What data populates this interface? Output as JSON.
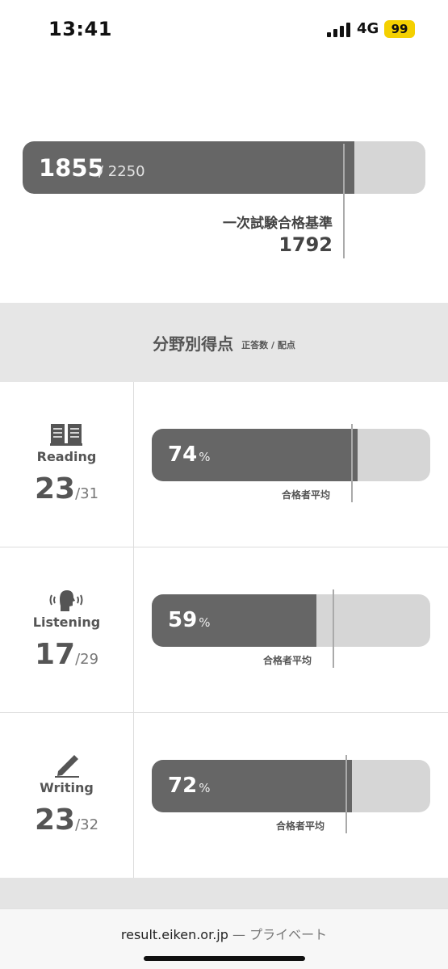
{
  "status": {
    "time": "13:41",
    "network": "4G",
    "battery": "99"
  },
  "total": {
    "score": "1855",
    "max": "/ 2250",
    "fill_ratio": 0.8244,
    "pass_label": "一次試験合格基準",
    "pass_value": "1792"
  },
  "section": {
    "title": "分野別得点",
    "subtitle": "正答数 / 配点"
  },
  "skills": [
    {
      "name": "Reading",
      "score": "23",
      "max": "/31",
      "percent": "74",
      "percent_unit": "%",
      "avg_label": "合格者平均",
      "icon": "book-icon",
      "percent_value": 74,
      "avg_value": 71.5
    },
    {
      "name": "Listening",
      "score": "17",
      "max": "/29",
      "percent": "59",
      "percent_unit": "%",
      "avg_label": "合格者平均",
      "icon": "listening-head-icon",
      "percent_value": 59,
      "avg_value": 65
    },
    {
      "name": "Writing",
      "score": "23",
      "max": "/32",
      "percent": "72",
      "percent_unit": "%",
      "avg_label": "合格者平均",
      "icon": "pencil-icon",
      "percent_value": 72,
      "avg_value": 69.5
    }
  ],
  "browser": {
    "url": "result.eiken.or.jp",
    "separator": "—",
    "mode": "プライベート"
  }
}
